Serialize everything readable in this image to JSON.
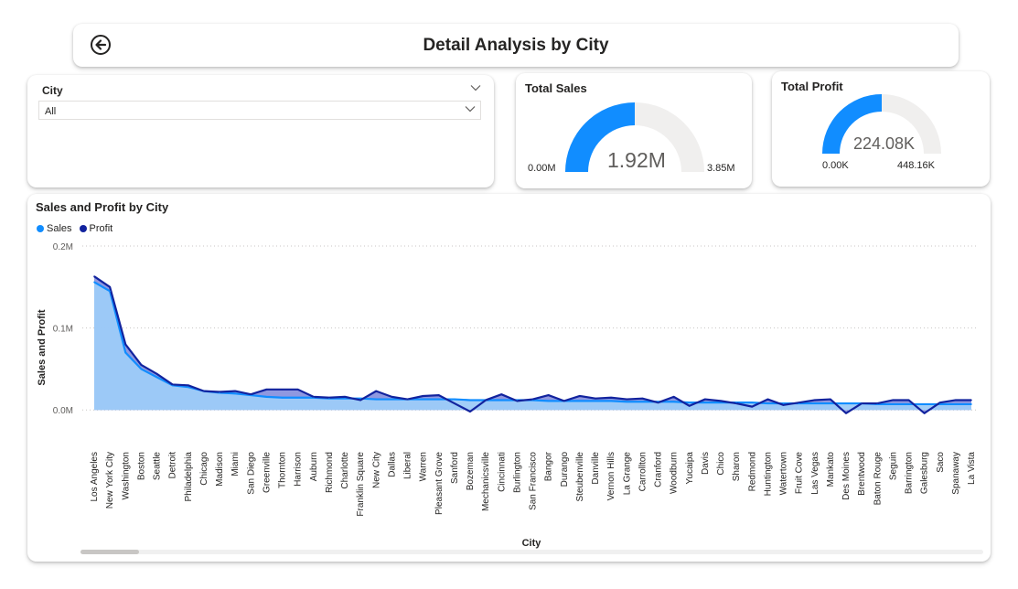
{
  "header": {
    "title": "Detail Analysis by City",
    "back_icon": "back-arrow-icon"
  },
  "slicer": {
    "label": "City",
    "value": "All"
  },
  "total_sales": {
    "title": "Total Sales",
    "value": "1.92M",
    "min": "0.00M",
    "max": "3.85M",
    "fraction": 0.5,
    "fill_color": "#118DFF",
    "track_color": "#F0EFEE"
  },
  "total_profit": {
    "title": "Total Profit",
    "value": "224.08K",
    "min": "0.00K",
    "max": "448.16K",
    "fraction": 0.5,
    "fill_color": "#118DFF",
    "track_color": "#F0EFEE"
  },
  "chart_data": {
    "type": "area",
    "title": "Sales and Profit by City",
    "xlabel": "City",
    "ylabel": "Sales and Profit",
    "ylim": [
      -0.005,
      0.2
    ],
    "y_ticks": [
      0,
      0.1,
      0.2
    ],
    "y_tick_labels": [
      "0.0M",
      "0.1M",
      "0.2M"
    ],
    "grid": true,
    "legend": "top-left",
    "categories": [
      "Los Angeles",
      "New York City",
      "Washington",
      "Boston",
      "Seattle",
      "Detroit",
      "Philadelphia",
      "Chicago",
      "Madison",
      "Miami",
      "San Diego",
      "Greenville",
      "Thornton",
      "Harrison",
      "Auburn",
      "Richmond",
      "Charlotte",
      "Franklin Square",
      "New City",
      "Dallas",
      "Liberal",
      "Warren",
      "Pleasant Grove",
      "Sanford",
      "Bozeman",
      "Mechanicsville",
      "Cincinnati",
      "Burlington",
      "San Francisco",
      "Bangor",
      "Durango",
      "Steubenville",
      "Danville",
      "Vernon Hills",
      "La Grange",
      "Carrollton",
      "Cranford",
      "Woodburn",
      "Yucaipa",
      "Davis",
      "Chico",
      "Sharon",
      "Redmond",
      "Huntington",
      "Watertown",
      "Fruit Cove",
      "Las Vegas",
      "Mankato",
      "Des Moines",
      "Brentwood",
      "Baton Rouge",
      "Seguin",
      "Barrington",
      "Galesburg",
      "Saco",
      "Spanaway",
      "La Vista"
    ],
    "series": [
      {
        "name": "Sales",
        "color": "#118DFF",
        "fill": "#9DCBF8",
        "values": [
          0.156,
          0.145,
          0.07,
          0.05,
          0.04,
          0.03,
          0.028,
          0.023,
          0.021,
          0.02,
          0.018,
          0.016,
          0.015,
          0.015,
          0.015,
          0.014,
          0.014,
          0.014,
          0.013,
          0.013,
          0.013,
          0.013,
          0.013,
          0.013,
          0.012,
          0.012,
          0.012,
          0.012,
          0.012,
          0.011,
          0.011,
          0.011,
          0.011,
          0.011,
          0.01,
          0.01,
          0.01,
          0.01,
          0.009,
          0.009,
          0.009,
          0.009,
          0.009,
          0.008,
          0.008,
          0.008,
          0.008,
          0.008,
          0.008,
          0.008,
          0.007,
          0.007,
          0.007,
          0.007,
          0.007,
          0.007,
          0.007
        ]
      },
      {
        "name": "Profit",
        "color": "#12239E",
        "values": [
          0.163,
          0.15,
          0.08,
          0.055,
          0.044,
          0.031,
          0.03,
          0.023,
          0.022,
          0.023,
          0.019,
          0.025,
          0.025,
          0.025,
          0.016,
          0.015,
          0.016,
          0.012,
          0.023,
          0.016,
          0.013,
          0.017,
          0.018,
          0.008,
          -0.002,
          0.012,
          0.019,
          0.011,
          0.013,
          0.018,
          0.011,
          0.017,
          0.014,
          0.015,
          0.013,
          0.014,
          0.009,
          0.016,
          0.005,
          0.013,
          0.011,
          0.008,
          0.004,
          0.013,
          0.006,
          0.009,
          0.012,
          0.013,
          -0.004,
          0.008,
          0.008,
          0.012,
          0.012,
          -0.004,
          0.009,
          0.012,
          0.012
        ]
      }
    ]
  }
}
